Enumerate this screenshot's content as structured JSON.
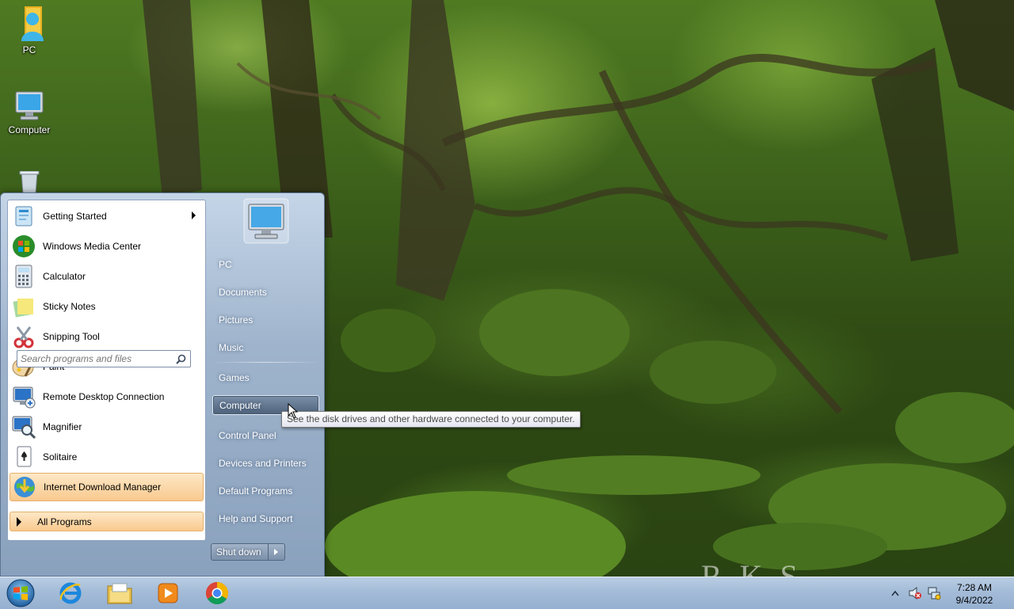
{
  "desktop": {
    "icons": [
      {
        "label": "PC",
        "icon": "user-folder-icon"
      },
      {
        "label": "Computer",
        "icon": "computer-icon"
      },
      {
        "label": "",
        "icon": "recycle-bin-icon"
      }
    ],
    "wallpaper_caption": "R     K     S"
  },
  "start_menu": {
    "programs": [
      {
        "label": "Getting Started",
        "icon": "getting-started-icon",
        "has_submenu": true
      },
      {
        "label": "Windows Media Center",
        "icon": "media-center-icon"
      },
      {
        "label": "Calculator",
        "icon": "calculator-icon"
      },
      {
        "label": "Sticky Notes",
        "icon": "sticky-notes-icon"
      },
      {
        "label": "Snipping Tool",
        "icon": "snipping-tool-icon"
      },
      {
        "label": "Paint",
        "icon": "paint-icon"
      },
      {
        "label": "Remote Desktop Connection",
        "icon": "remote-desktop-icon"
      },
      {
        "label": "Magnifier",
        "icon": "magnifier-icon"
      },
      {
        "label": "Solitaire",
        "icon": "solitaire-icon"
      },
      {
        "label": "Internet Download Manager",
        "icon": "idm-icon",
        "highlighted": true
      }
    ],
    "all_programs": "All Programs",
    "search_placeholder": "Search programs and files",
    "right_items": [
      {
        "label": "PC"
      },
      {
        "label": "Documents"
      },
      {
        "label": "Pictures"
      },
      {
        "label": "Music"
      },
      {
        "label": "Games"
      },
      {
        "label": "Computer",
        "hovered": true
      },
      {
        "label": "Control Panel"
      },
      {
        "label": "Devices and Printers"
      },
      {
        "label": "Default Programs"
      },
      {
        "label": "Help and Support"
      }
    ],
    "shutdown_label": "Shut down",
    "tooltip": "See the disk drives and other hardware connected to your computer."
  },
  "taskbar": {
    "pinned": [
      {
        "name": "internet-explorer-icon"
      },
      {
        "name": "file-explorer-icon"
      },
      {
        "name": "media-player-icon"
      },
      {
        "name": "chrome-icon"
      }
    ],
    "clock": {
      "time": "7:28 AM",
      "date": "9/4/2022"
    },
    "tray": [
      "show-hidden-icons-icon",
      "volume-muted-icon",
      "network-icon"
    ]
  },
  "colors": {
    "accent_highlight": "#f9c98e",
    "start_menu_right": "#8aa1bd",
    "taskbar": "#a4bcd8"
  }
}
